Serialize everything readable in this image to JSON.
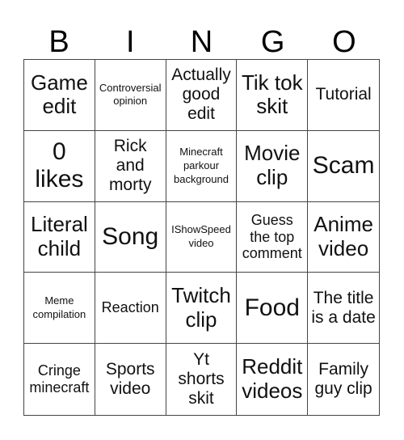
{
  "header": {
    "letters": [
      "B",
      "I",
      "N",
      "G",
      "O"
    ]
  },
  "cells": [
    "Game edit",
    "Controversial opinion",
    "Actually good edit",
    "Tik tok skit",
    "Tutorial",
    "0 likes",
    "Rick and morty",
    "Minecraft parkour background",
    "Movie clip",
    "Scam",
    "Literal child",
    "Song",
    "IShowSpeed video",
    "Guess the top comment",
    "Anime video",
    "Meme compilation",
    "Reaction",
    "Twitch clip",
    "Food",
    "The title is a date",
    "Cringe minecraft",
    "Sports video",
    "Yt shorts skit",
    "Reddit videos",
    "Family guy clip"
  ]
}
